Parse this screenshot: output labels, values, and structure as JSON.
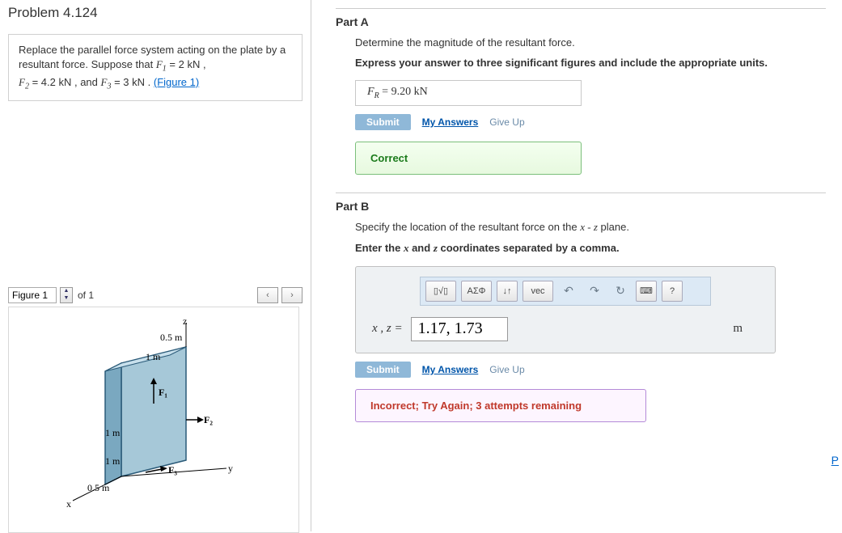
{
  "problem": {
    "title": "Problem 4.124",
    "prompt_lines": [
      "Replace the parallel force system acting on the plate by a resultant force. Suppose that ",
      " = 2  kN , ",
      " = 4.2  kN , and ",
      " = 3  kN . "
    ],
    "F1": "F₁",
    "F2": "F₂",
    "F3": "F₃",
    "figure_link": "(Figure 1)"
  },
  "figure": {
    "label": "Figure 1",
    "of": "of 1",
    "dims": {
      "z_top": "0.5 m",
      "z_mid": "1 m",
      "x_top": "1 m",
      "x_mid": "1 m",
      "x_bot": "0.5 m"
    },
    "axes": {
      "x": "x",
      "y": "y",
      "z": "z"
    },
    "forces": {
      "f1": "F₁",
      "f2": "F₂",
      "f3": "F₃"
    }
  },
  "partA": {
    "title": "Part A",
    "desc": "Determine the magnitude of the resultant force.",
    "bold": "Express your answer to three significant figures and include the appropriate units.",
    "answer_label": "F_R =",
    "answer_value": "9.20 kN",
    "submit": "Submit",
    "my_answers": "My Answers",
    "give_up": "Give Up",
    "correct": "Correct"
  },
  "partB": {
    "title": "Part B",
    "desc_prefix": "Specify the location of the resultant force on the ",
    "desc_plane": "x - z",
    "desc_suffix": " plane.",
    "bold_prefix": "Enter the ",
    "bold_x": "x",
    "bold_and": " and ",
    "bold_z": "z",
    "bold_suffix": " coordinates separated by a comma.",
    "toolbar": {
      "tpl": "▯√▯",
      "greek": "ΑΣΦ",
      "updown": "↓↑",
      "vec": "vec",
      "undo": "↶",
      "redo": "↷",
      "reset": "↻",
      "kbd": "⌨",
      "help": "?"
    },
    "eq_label": "x ,  z  =",
    "eq_value": "1.17, 1.73",
    "eq_unit": "m",
    "submit": "Submit",
    "my_answers": "My Answers",
    "give_up": "Give Up",
    "incorrect": "Incorrect; Try Again; 3 attempts remaining"
  },
  "footer_link": "P"
}
